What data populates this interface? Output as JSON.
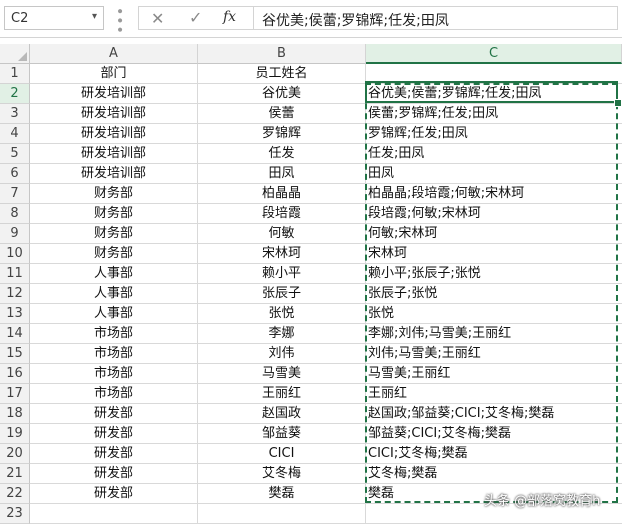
{
  "namebox": {
    "value": "C2",
    "arrow": "▾"
  },
  "formula": {
    "cancel_glyph": "✕",
    "confirm_glyph": "✓",
    "fx_glyph": "fx",
    "value": "谷优美;侯蕾;罗锦辉;任发;田凤"
  },
  "columns": [
    "A",
    "B",
    "C"
  ],
  "rows": [
    {
      "num": "1",
      "a": "部门",
      "b": "员工姓名",
      "c": ""
    },
    {
      "num": "2",
      "a": "研发培训部",
      "b": "谷优美",
      "c": "谷优美;侯蕾;罗锦辉;任发;田凤"
    },
    {
      "num": "3",
      "a": "研发培训部",
      "b": "侯蕾",
      "c": "侯蕾;罗锦辉;任发;田凤"
    },
    {
      "num": "4",
      "a": "研发培训部",
      "b": "罗锦辉",
      "c": "罗锦辉;任发;田凤"
    },
    {
      "num": "5",
      "a": "研发培训部",
      "b": "任发",
      "c": "任发;田凤"
    },
    {
      "num": "6",
      "a": "研发培训部",
      "b": "田凤",
      "c": "田凤"
    },
    {
      "num": "7",
      "a": "财务部",
      "b": "柏晶晶",
      "c": "柏晶晶;段培霞;何敏;宋林珂"
    },
    {
      "num": "8",
      "a": "财务部",
      "b": "段培霞",
      "c": "段培霞;何敏;宋林珂"
    },
    {
      "num": "9",
      "a": "财务部",
      "b": "何敏",
      "c": "何敏;宋林珂"
    },
    {
      "num": "10",
      "a": "财务部",
      "b": "宋林珂",
      "c": "宋林珂"
    },
    {
      "num": "11",
      "a": "人事部",
      "b": "赖小平",
      "c": "赖小平;张辰子;张悦"
    },
    {
      "num": "12",
      "a": "人事部",
      "b": "张辰子",
      "c": "张辰子;张悦"
    },
    {
      "num": "13",
      "a": "人事部",
      "b": "张悦",
      "c": "张悦"
    },
    {
      "num": "14",
      "a": "市场部",
      "b": "李娜",
      "c": "李娜;刘伟;马雪美;王丽红"
    },
    {
      "num": "15",
      "a": "市场部",
      "b": "刘伟",
      "c": "刘伟;马雪美;王丽红"
    },
    {
      "num": "16",
      "a": "市场部",
      "b": "马雪美",
      "c": "马雪美;王丽红"
    },
    {
      "num": "17",
      "a": "市场部",
      "b": "王丽红",
      "c": "王丽红"
    },
    {
      "num": "18",
      "a": "研发部",
      "b": "赵国政",
      "c": "赵国政;邹益葵;CICI;艾冬梅;樊磊"
    },
    {
      "num": "19",
      "a": "研发部",
      "b": "邹益葵",
      "c": "邹益葵;CICI;艾冬梅;樊磊"
    },
    {
      "num": "20",
      "a": "研发部",
      "b": "CICI",
      "c": "CICI;艾冬梅;樊磊"
    },
    {
      "num": "21",
      "a": "研发部",
      "b": "艾冬梅",
      "c": "艾冬梅;樊磊"
    },
    {
      "num": "22",
      "a": "研发部",
      "b": "樊磊",
      "c": "樊磊"
    },
    {
      "num": "23",
      "a": "",
      "b": "",
      "c": ""
    }
  ],
  "watermark": "头条 @部落窝教育h",
  "colors": {
    "accent": "#217346"
  }
}
